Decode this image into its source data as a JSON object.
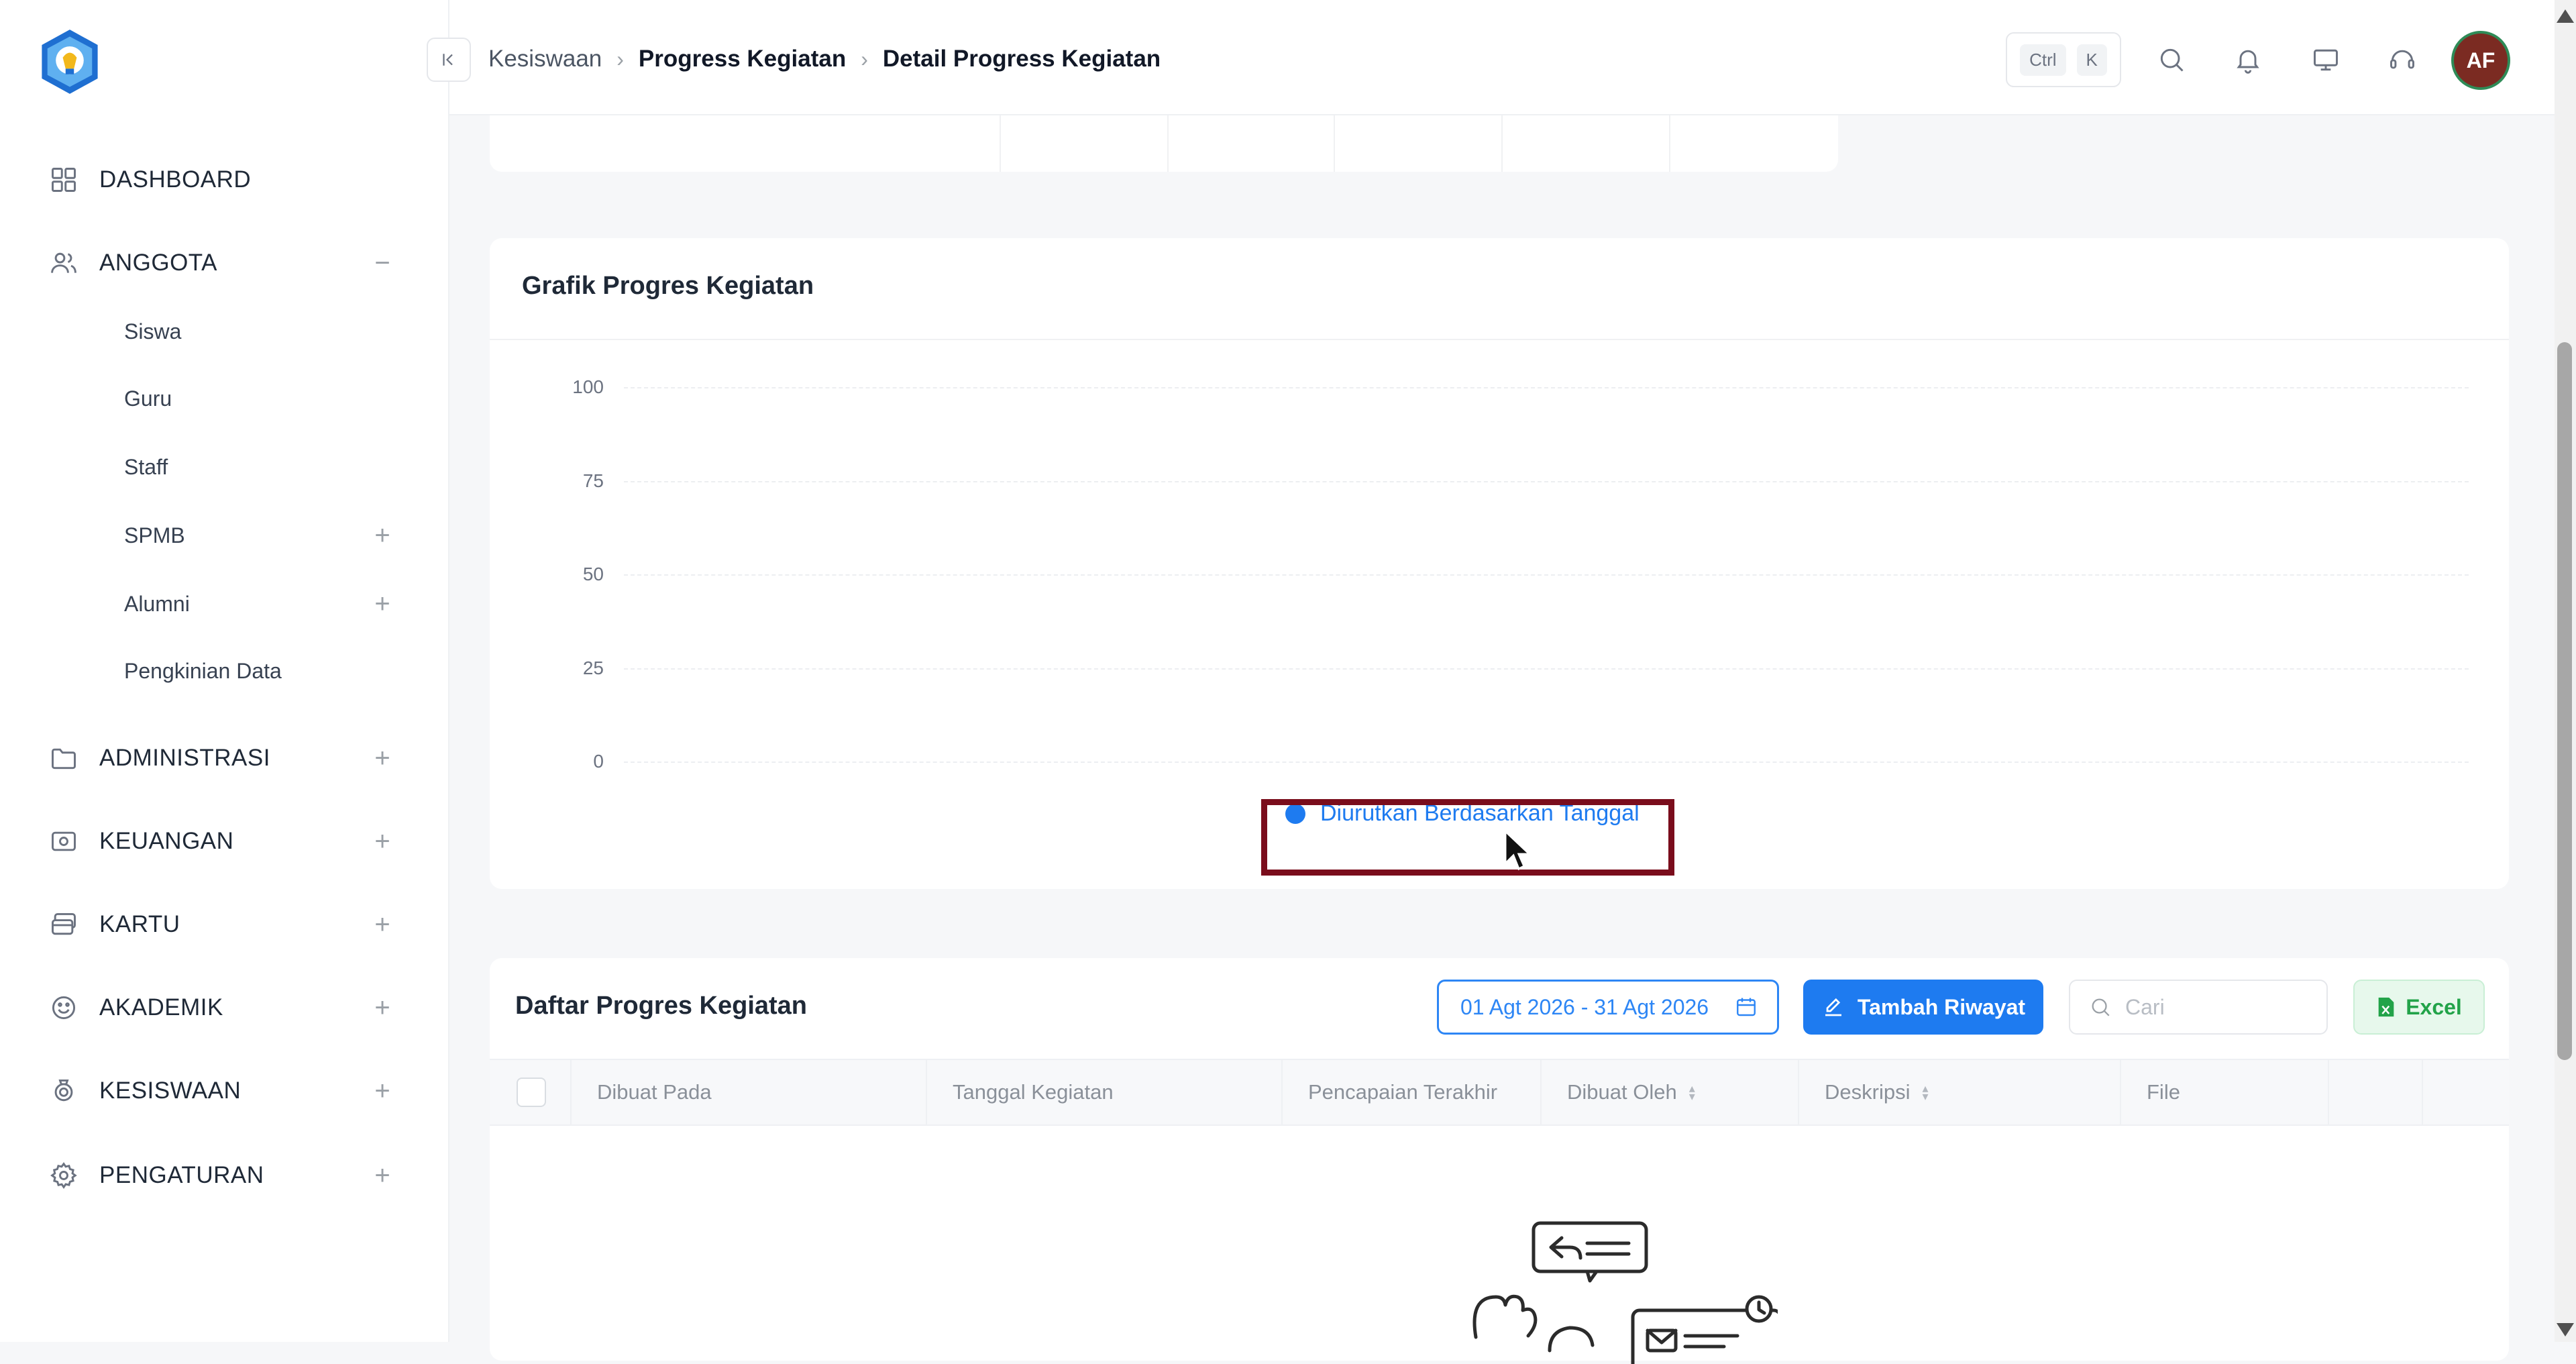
{
  "sidebar": {
    "items": [
      {
        "label": "DASHBOARD"
      },
      {
        "label": "ANGGOTA",
        "expander": "−",
        "children": [
          {
            "label": "Siswa"
          },
          {
            "label": "Guru"
          },
          {
            "label": "Staff"
          },
          {
            "label": "SPMB",
            "expander": "+"
          },
          {
            "label": "Alumni",
            "expander": "+"
          },
          {
            "label": "Pengkinian Data"
          }
        ]
      },
      {
        "label": "ADMINISTRASI",
        "expander": "+"
      },
      {
        "label": "KEUANGAN",
        "expander": "+"
      },
      {
        "label": "KARTU",
        "expander": "+"
      },
      {
        "label": "AKADEMIK",
        "expander": "+"
      },
      {
        "label": "KESISWAAN",
        "expander": "+"
      },
      {
        "label": "PENGATURAN",
        "expander": "+"
      }
    ]
  },
  "header": {
    "breadcrumb": [
      "Kesiswaan",
      "Progress Kegiatan",
      "Detail Progress Kegiatan"
    ],
    "shortcut_keys": [
      "Ctrl",
      "K"
    ],
    "avatar_initials": "AF"
  },
  "chart_card": {
    "title": "Grafik Progres Kegiatan"
  },
  "chart_data": {
    "type": "line",
    "ylim": [
      0,
      100
    ],
    "yticks": [
      "100",
      "75",
      "50",
      "25",
      "0"
    ],
    "grid": true,
    "legend_placement": "bottom-center",
    "series": [
      {
        "name": "Diurutkan Berdasarkan Tanggal",
        "color": "#1e7bf0",
        "values": []
      }
    ]
  },
  "table_card": {
    "title": "Daftar Progres Kegiatan",
    "date_range": "01 Agt 2026 - 31 Agt 2026",
    "add_button": "Tambah Riwayat",
    "search_placeholder": "Cari",
    "excel_button": "Excel",
    "columns": [
      "Dibuat Pada",
      "Tanggal Kegiatan",
      "Pencapaian Terakhir",
      "Dibuat Oleh",
      "Deskripsi",
      "File"
    ]
  },
  "colors": {
    "accent": "#1e7bf0",
    "highlight": "#7a0d1c",
    "excel": "#22a349"
  }
}
